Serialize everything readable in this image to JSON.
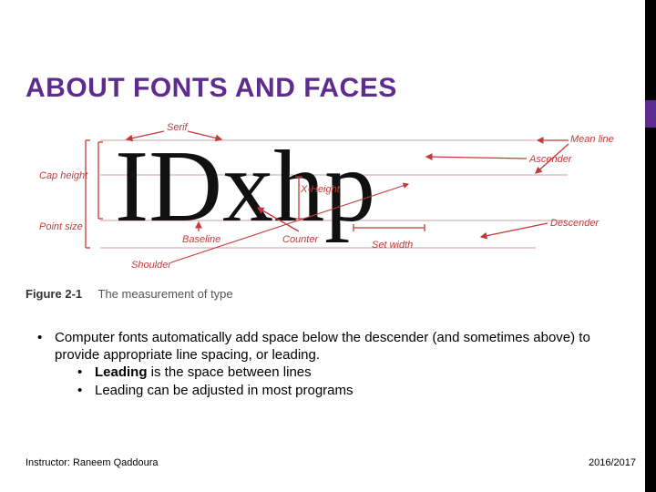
{
  "title": "ABOUT FONTS AND FACES",
  "diagram": {
    "sampleText": "IDxhp",
    "labels": {
      "serif": "Serif",
      "meanLine": "Mean line",
      "ascender": "Ascender",
      "capHeight": "Cap height",
      "xHeight": "X-Height",
      "pointSize": "Point size",
      "baseline": "Baseline",
      "counter": "Counter",
      "setWidth": "Set width",
      "descender": "Descender",
      "shoulder": "Shoulder"
    },
    "colors": {
      "labelText": "#C23A3A",
      "arrow": "#C23A3A",
      "guide": "#C8A0A0",
      "glyph": "#111111"
    }
  },
  "figure": {
    "number": "Figure 2-1",
    "caption": "The measurement of type"
  },
  "bullets": {
    "top": "Computer fonts automatically add space below the descender (and sometimes above) to provide appropriate line spacing, or leading.",
    "sub": [
      {
        "bold": "Leading",
        "rest": " is the space between lines"
      },
      {
        "plain": "Leading can be adjusted in most programs"
      }
    ]
  },
  "footer": {
    "instructor": "Instructor: Raneem Qaddoura",
    "year": "2016/2017"
  }
}
